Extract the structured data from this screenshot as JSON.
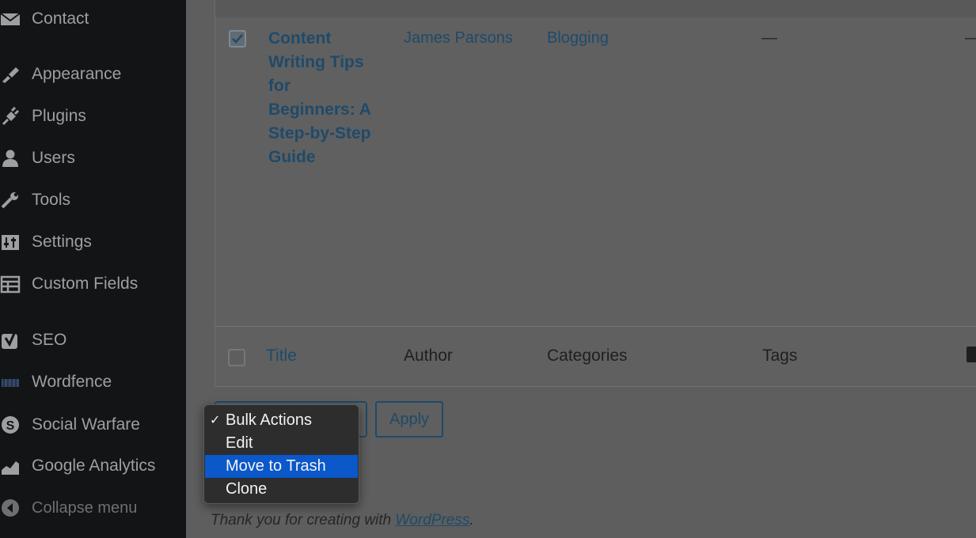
{
  "sidebar": {
    "items": [
      {
        "label": "Contact",
        "icon": "mail-icon"
      },
      {
        "label": "Appearance",
        "icon": "paintbrush-icon"
      },
      {
        "label": "Plugins",
        "icon": "plugin-icon"
      },
      {
        "label": "Users",
        "icon": "user-icon"
      },
      {
        "label": "Tools",
        "icon": "wrench-icon"
      },
      {
        "label": "Settings",
        "icon": "sliders-icon"
      },
      {
        "label": "Custom Fields",
        "icon": "table-icon"
      },
      {
        "label": "SEO",
        "icon": "yoast-icon"
      },
      {
        "label": "Wordfence",
        "icon": "wordfence-icon"
      },
      {
        "label": "Social Warfare",
        "icon": "social-warfare-icon"
      },
      {
        "label": "Google Analytics",
        "icon": "analytics-icon"
      }
    ],
    "collapse_label": "Collapse menu"
  },
  "post_row": {
    "title": "Content Writing Tips for Beginners: A Step-by-Step Guide",
    "author": "James Parsons",
    "category": "Blogging",
    "tags": "—",
    "comments": "—",
    "checked": true
  },
  "table_footer_headers": {
    "title": "Title",
    "author": "Author",
    "categories": "Categories",
    "tags": "Tags"
  },
  "bulk": {
    "menu_items": [
      {
        "label": "Bulk Actions",
        "selected": true
      },
      {
        "label": "Edit",
        "selected": false
      },
      {
        "label": "Move to Trash",
        "highlighted": true
      },
      {
        "label": "Clone",
        "selected": false
      }
    ],
    "checkmark": "✓",
    "apply_label": "Apply"
  },
  "footer": {
    "prefix": "Thank you for creating with ",
    "link": "WordPress",
    "suffix": "."
  },
  "colors": {
    "sidebar_bg": "#121416",
    "link": "#1f4a6a",
    "menu_highlight": "#0a58c9"
  }
}
